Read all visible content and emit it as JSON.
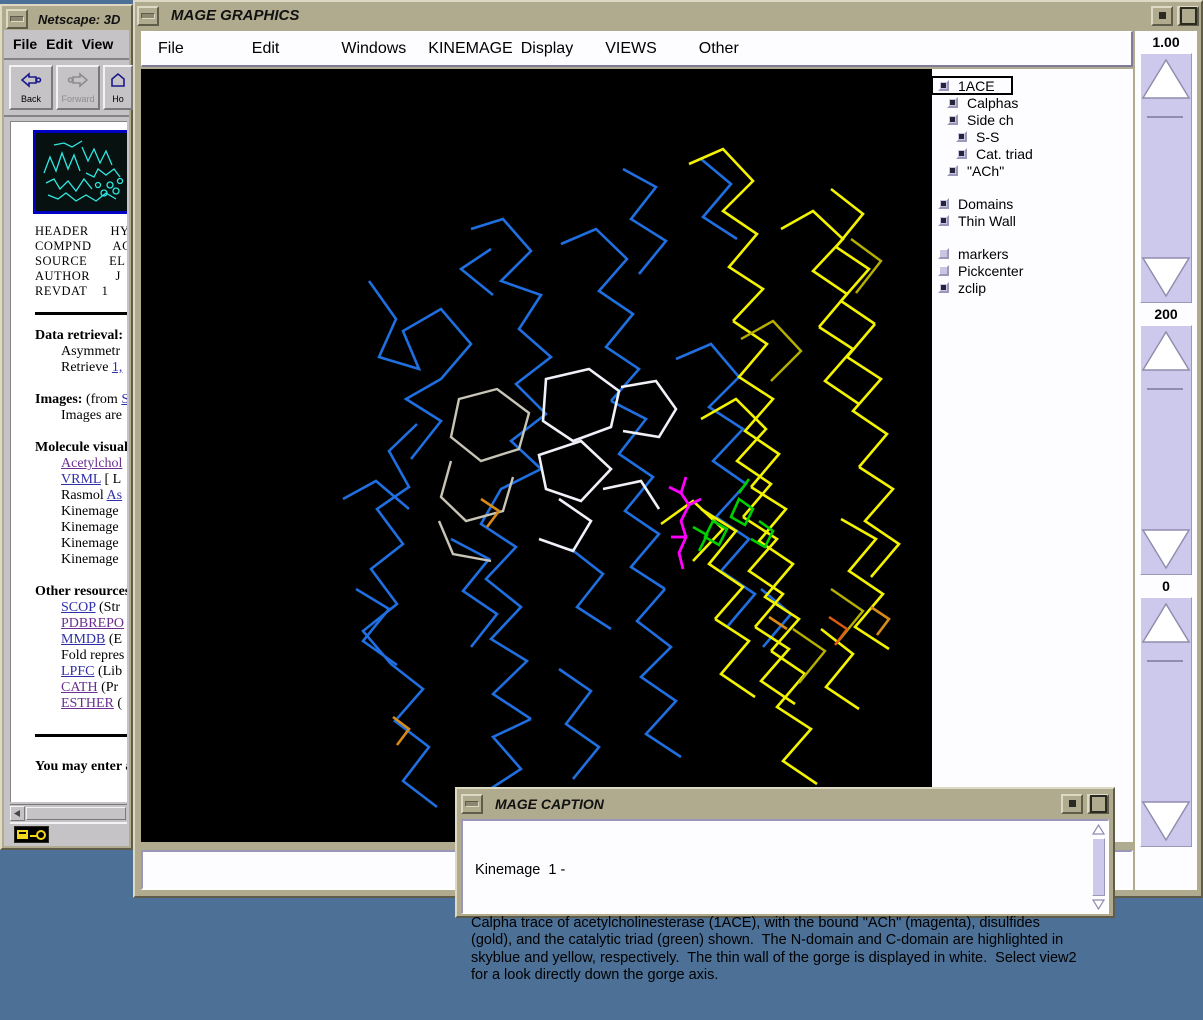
{
  "desktop": {
    "background": "#4c7096"
  },
  "netscape": {
    "title": "Netscape: 3D",
    "menus": [
      "File",
      "Edit",
      "View"
    ],
    "toolbar": [
      {
        "label": "Back",
        "icon": "back-arrow-icon",
        "disabled": false
      },
      {
        "label": "Forward",
        "icon": "forward-arrow-icon",
        "disabled": true
      },
      {
        "label": "Ho",
        "icon": "home-icon",
        "disabled": false
      }
    ],
    "page": {
      "thumbnail_alt": "T",
      "pdb_records": "HEADER      HY\nCOMPND      AC\nSOURCE      EL\nAUTHOR       J\nREVDAT    1",
      "sections": [
        {
          "heading": "Data retrieval:",
          "lines": [
            {
              "text": "Asymmetr",
              "link": null
            },
            {
              "text": "Retrieve ",
              "link": "1,"
            }
          ]
        },
        {
          "heading": "Images:",
          "heading_suffix": " (from ",
          "heading_link": "SW",
          "lines": [
            {
              "text": "Images are",
              "link": null
            }
          ]
        },
        {
          "heading": "Molecule visualiz",
          "lines": [
            {
              "text": "",
              "link": "Acetylchol"
            },
            {
              "text": " [ L",
              "link": "VRML"
            },
            {
              "text": "Rasmol ",
              "link": "As"
            },
            {
              "text": "Kinemage",
              "link": null
            },
            {
              "text": "Kinemage",
              "link": null
            },
            {
              "text": "Kinemage",
              "link": null
            },
            {
              "text": "Kinemage",
              "link": null
            }
          ]
        },
        {
          "heading": "Other resources v",
          "lines": [
            {
              "text": " (Str",
              "link": "SCOP"
            },
            {
              "text": "",
              "link": "PDBREPO"
            },
            {
              "text": " (E",
              "link": "MMDB"
            },
            {
              "text": "Fold repres",
              "link": null
            },
            {
              "text": " (Lib",
              "link": "LPFC"
            },
            {
              "text": " (Pr",
              "link": "CATH"
            },
            {
              "text": " (",
              "link": "ESTHER"
            }
          ]
        }
      ],
      "footer": "You may enter an"
    },
    "status_icon": "security-key-icon"
  },
  "mage": {
    "title": "MAGE GRAPHICS",
    "menus": [
      "File",
      "Edit",
      "Windows",
      "KINEMAGE",
      "Display",
      "VIEWS",
      "Other"
    ],
    "titlebar_buttons": [
      "minimize-button",
      "restore-button",
      "maximize-button"
    ],
    "panel_items": [
      {
        "label": "1ACE",
        "checked": true,
        "indent": 0,
        "focused": true,
        "gap_before": false
      },
      {
        "label": "Calphas",
        "checked": true,
        "indent": 1,
        "focused": false,
        "gap_before": false
      },
      {
        "label": "Side ch",
        "checked": true,
        "indent": 1,
        "focused": false,
        "gap_before": false
      },
      {
        "label": "S-S",
        "checked": true,
        "indent": 2,
        "focused": false,
        "gap_before": false
      },
      {
        "label": "Cat. triad",
        "checked": true,
        "indent": 2,
        "focused": false,
        "gap_before": false
      },
      {
        "label": "\"ACh\"",
        "checked": true,
        "indent": 1,
        "focused": false,
        "gap_before": false
      },
      {
        "label": "Domains",
        "checked": true,
        "indent": 0,
        "focused": false,
        "gap_before": true
      },
      {
        "label": "Thin Wall",
        "checked": true,
        "indent": 0,
        "focused": false,
        "gap_before": false
      },
      {
        "label": "markers",
        "checked": false,
        "indent": 0,
        "focused": false,
        "gap_before": true
      },
      {
        "label": "Pickcenter",
        "checked": false,
        "indent": 0,
        "focused": false,
        "gap_before": false
      },
      {
        "label": "zclip",
        "checked": true,
        "indent": 0,
        "focused": false,
        "gap_before": false
      }
    ],
    "sliders": [
      {
        "name": "zoom-slider",
        "value": "1.00"
      },
      {
        "name": "clipping-slider",
        "value": "200"
      },
      {
        "name": "zslab-slider",
        "value": "0"
      }
    ],
    "command_input": {
      "value": "",
      "placeholder": ""
    },
    "graphics": {
      "background": "#000000",
      "colors": {
        "n_domain": "#1f6fe0",
        "c_domain": "#f3f300",
        "ach": "#ff00ff",
        "cat_triad": "#00d000",
        "thin_wall": "#f0f0f8",
        "disulfide": "#d98b18"
      }
    }
  },
  "caption": {
    "title": "MAGE CAPTION",
    "heading": " Kinemage  1 -",
    "text": "Calpha trace of acetylcholinesterase (1ACE), with the bound \"ACh\" (magenta), disulfides (gold), and the catalytic triad (green) shown.  The N-domain and C-domain are highlighted in skyblue and yellow, respectively.  The thin wall of the gorge is displayed in white.  Select view2 for a look directly down the gorge axis."
  }
}
